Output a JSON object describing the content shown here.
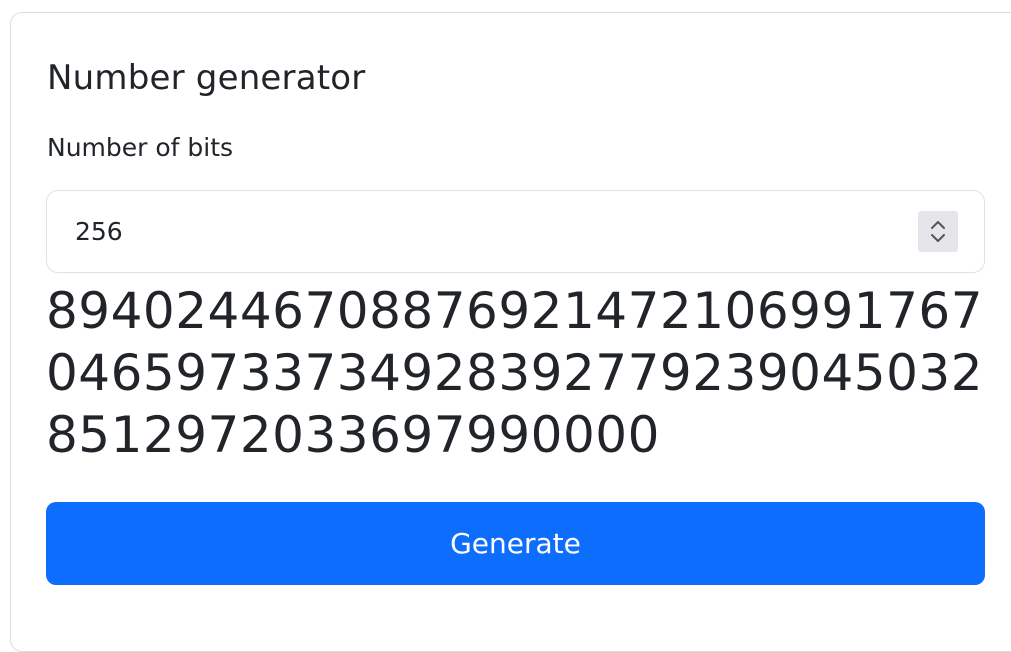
{
  "card": {
    "title": "Number generator"
  },
  "bits_field": {
    "label": "Number of bits",
    "value": "256"
  },
  "result": {
    "number": "89402446708876921472106991767046597337349283927792390450328512972033697990000"
  },
  "actions": {
    "generate_label": "Generate"
  },
  "colors": {
    "primary": "#0d6efd",
    "text": "#212529",
    "border": "#dee2e6",
    "spinner_bg": "#e6e6ea"
  },
  "icons": {
    "spinner": "up-down-chevrons-icon"
  }
}
